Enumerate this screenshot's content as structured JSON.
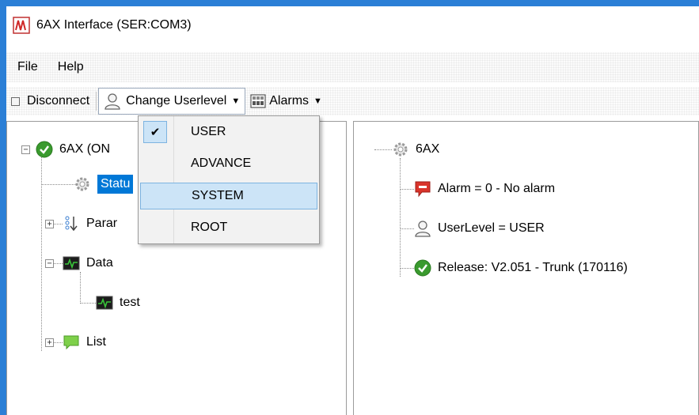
{
  "window": {
    "title": "6AX Interface (SER:COM3)"
  },
  "menu": {
    "file": "File",
    "help": "Help"
  },
  "toolbar": {
    "disconnect": "Disconnect",
    "change_userlevel": "Change Userlevel",
    "alarms": "Alarms"
  },
  "dropdown": {
    "items": [
      "USER",
      "ADVANCE",
      "SYSTEM",
      "ROOT"
    ],
    "checked": "USER",
    "highlighted": "SYSTEM"
  },
  "left_tree": {
    "root": "6AX (ON",
    "status": "Statu",
    "params": "Parar",
    "data": "Data",
    "test": "test",
    "list": "List"
  },
  "right_tree": {
    "root": "6AX",
    "alarm": "Alarm = 0 - No alarm",
    "userlevel": "UserLevel = USER",
    "release": "Release: V2.051 - Trunk  (170116)"
  },
  "colors": {
    "titlebar_accent": "#2b7fd6",
    "selection": "#0078d7",
    "menu_highlight": "#cce4f7",
    "ok_green": "#3a9a2e",
    "alarm_red": "#d9342b"
  }
}
